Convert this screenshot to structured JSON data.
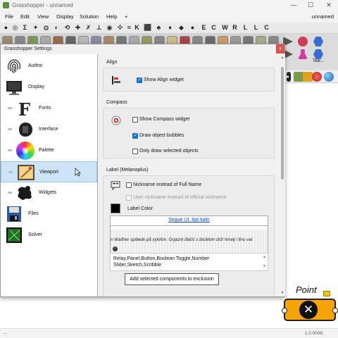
{
  "window": {
    "title": "Grasshopper - unnamed",
    "document_name": "unnamed",
    "controls": [
      "—",
      "☐",
      "✕"
    ]
  },
  "menu": [
    "File",
    "Edit",
    "View",
    "Display",
    "Solution",
    "Help",
    "+"
  ],
  "toolbar": {
    "letters": [
      "K",
      "E",
      "C",
      "W",
      "R",
      "L",
      "L",
      "C"
    ]
  },
  "right_panel": {
    "label": "Tele..."
  },
  "status": {
    "dots": "...",
    "version": "1.0.0008"
  },
  "point_component": {
    "label": "Point"
  },
  "dialog": {
    "title": "Grasshopper Settings",
    "close": "x",
    "nav": [
      {
        "label": "Author",
        "icon": "fingerprint-icon",
        "sub": false,
        "selected": false
      },
      {
        "label": "Display",
        "icon": "monitor-icon",
        "sub": false,
        "selected": false
      },
      {
        "label": "Fonts",
        "icon": "font-icon",
        "sub": true,
        "selected": false
      },
      {
        "label": "Interface",
        "icon": "interface-icon",
        "sub": true,
        "selected": false
      },
      {
        "label": "Palette",
        "icon": "palette-icon",
        "sub": true,
        "selected": false
      },
      {
        "label": "Viewport",
        "icon": "viewport-icon",
        "sub": true,
        "selected": true
      },
      {
        "label": "Widgets",
        "icon": "widgets-icon",
        "sub": true,
        "selected": false
      },
      {
        "label": "Files",
        "icon": "files-icon",
        "sub": false,
        "selected": false
      },
      {
        "label": "Solver",
        "icon": "solver-icon",
        "sub": false,
        "selected": false
      }
    ],
    "align": {
      "title": "Align",
      "show_align_widget": {
        "label": "Show Align widget",
        "checked": true
      }
    },
    "compass": {
      "title": "Compass",
      "show_compass_widget": {
        "label": "Show Compass widget",
        "checked": false
      },
      "draw_object_bubbles": {
        "label": "Draw object bubbles",
        "checked": true
      },
      "only_draw_selected": {
        "label": "Only draw selected objects",
        "checked": false
      }
    },
    "label_melanoplus": {
      "title": "Label (Melanoplus)",
      "nickname_full_name": {
        "label": "Nickname instead of Full Name",
        "checked": false
      },
      "user_nickname": {
        "label": "User nickname instead of official nickname",
        "checked": false,
        "disabled": true
      },
      "label_color": "Label Color",
      "label_color_value": "#000000",
      "font_link": "Segoe UI, 8pt italic",
      "sample_text": "n Walther spillede på xylofon.      Gojazni đačić s biciklom drži hmelj i finu vat",
      "exclusion_list": "Relay,Panel,Button,Boolean Toggle,Number Slider,Sketch,Scribble",
      "exclusion_button": "Add selected components to exclusion"
    }
  }
}
